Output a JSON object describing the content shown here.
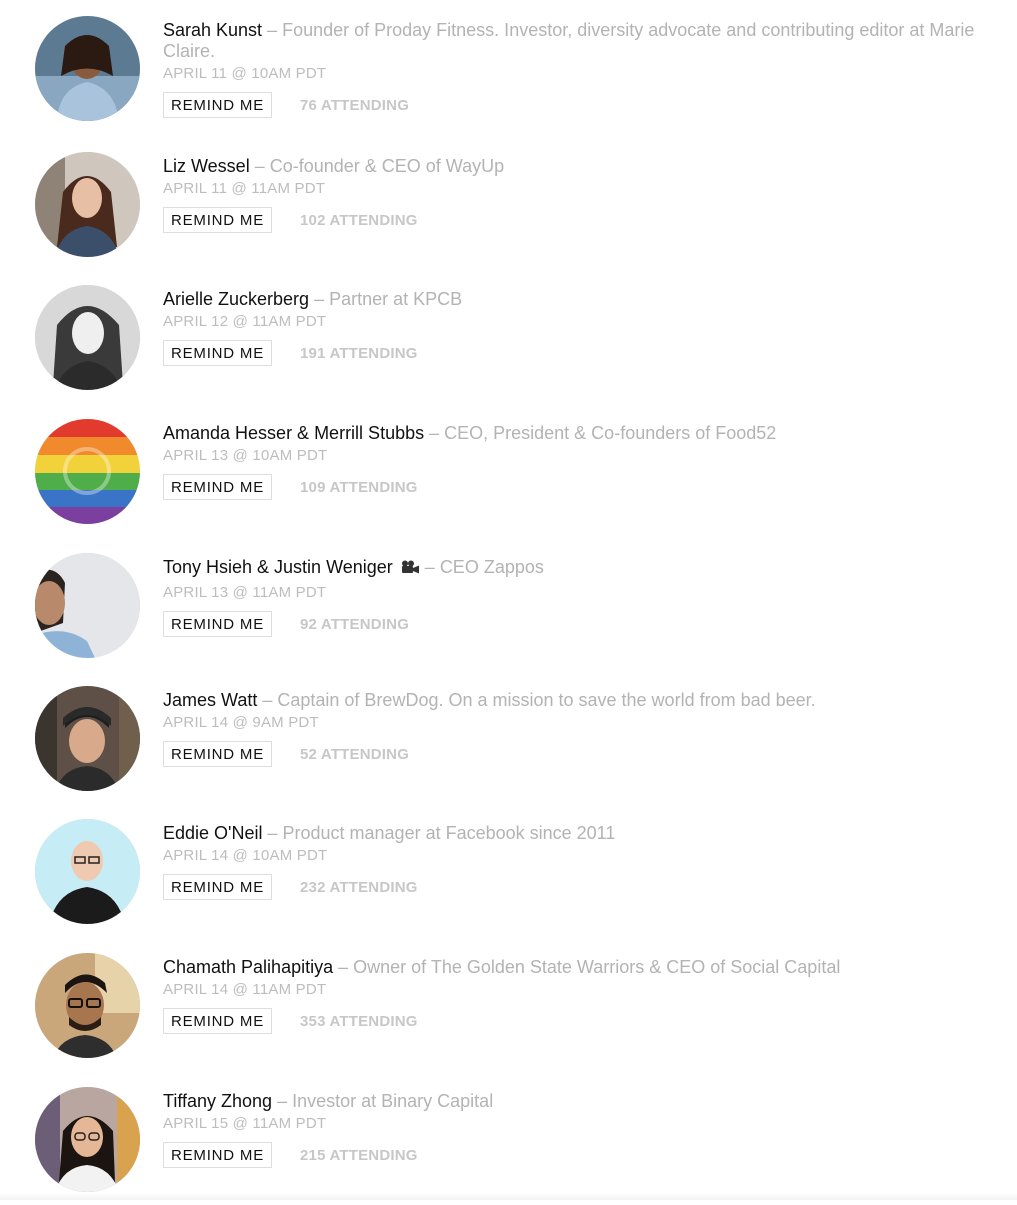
{
  "events": [
    {
      "speaker": "Sarah Kunst",
      "separator": " – ",
      "description": "Founder of Proday Fitness. Investor, diversity advocate and contributing editor at Marie Claire.",
      "date": "APRIL 11 @ 10AM PDT",
      "button_label": "REMIND ME",
      "attending": "76 ATTENDING",
      "avatar": "portrait-photo"
    },
    {
      "speaker": "Liz Wessel",
      "separator": " – ",
      "description": "Co-founder & CEO of WayUp",
      "date": "APRIL 11 @ 11AM PDT",
      "button_label": "REMIND ME",
      "attending": "102 ATTENDING",
      "avatar": "portrait-photo"
    },
    {
      "speaker": "Arielle Zuckerberg",
      "separator": " – ",
      "description": "Partner at KPCB",
      "date": "APRIL 12 @ 11AM PDT",
      "button_label": "REMIND ME",
      "attending": "191 ATTENDING",
      "avatar": "portrait-photo-bw"
    },
    {
      "speaker": "Amanda Hesser & Merrill Stubbs",
      "separator": " – ",
      "description": "CEO, President & Co-founders of Food52",
      "date": "APRIL 13 @ 10AM PDT",
      "button_label": "REMIND ME",
      "attending": "109 ATTENDING",
      "avatar": "rainbow-logo"
    },
    {
      "speaker": "Tony Hsieh & Justin Weniger",
      "icon": "movie-camera-icon",
      "separator": " – ",
      "description": "CEO Zappos",
      "date": "APRIL 13 @ 11AM PDT",
      "button_label": "REMIND ME",
      "attending": "92 ATTENDING",
      "avatar": "portrait-photo"
    },
    {
      "speaker": "James Watt",
      "separator": " – ",
      "description": "Captain of BrewDog. On a mission to save the world from bad beer.",
      "date": "APRIL 14 @ 9AM PDT",
      "button_label": "REMIND ME",
      "attending": "52 ATTENDING",
      "avatar": "portrait-photo"
    },
    {
      "speaker": "Eddie O'Neil",
      "separator": " – ",
      "description": "Product manager at Facebook since 2011",
      "date": "APRIL 14 @ 10AM PDT",
      "button_label": "REMIND ME",
      "attending": "232 ATTENDING",
      "avatar": "portrait-photo"
    },
    {
      "speaker": "Chamath Palihapitiya",
      "separator": " – ",
      "description": "Owner of The Golden State Warriors & CEO of Social Capital",
      "date": "APRIL 14 @ 11AM PDT",
      "button_label": "REMIND ME",
      "attending": "353 ATTENDING",
      "avatar": "portrait-photo"
    },
    {
      "speaker": "Tiffany Zhong",
      "separator": " – ",
      "description": "Investor at Binary Capital",
      "date": "APRIL 15 @ 11AM PDT",
      "button_label": "REMIND ME",
      "attending": "215 ATTENDING",
      "avatar": "portrait-photo"
    }
  ],
  "colors": {
    "speaker": "#111111",
    "muted": "#b3b3b3",
    "date": "#bdbdbd",
    "attending": "#c7c7c7",
    "button_border": "#dedede"
  }
}
